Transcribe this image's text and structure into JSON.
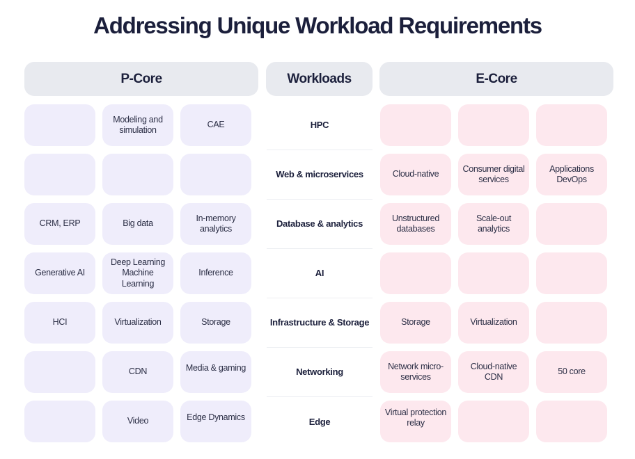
{
  "title": "Addressing Unique Workload Requirements",
  "headers": {
    "p_core": "P-Core",
    "workloads": "Workloads",
    "e_core": "E-Core"
  },
  "colors": {
    "title_text": "#1b1f3b",
    "header_bg": "#e8eaef",
    "p_core_cell_bg": "#efedfb",
    "e_core_cell_bg": "#fde8ee",
    "divider": "#eceef2"
  },
  "rows": [
    {
      "workload": "HPC",
      "p_core": [
        "",
        "Modeling and simulation",
        "CAE"
      ],
      "e_core": [
        "",
        "",
        ""
      ]
    },
    {
      "workload": "Web & microservices",
      "p_core": [
        "",
        "",
        ""
      ],
      "e_core": [
        "Cloud-native",
        "Consumer digital services",
        "Applications DevOps"
      ]
    },
    {
      "workload": "Database & analytics",
      "p_core": [
        "CRM, ERP",
        "Big data",
        "In-memory analytics"
      ],
      "e_core": [
        "Unstructured databases",
        "Scale-out analytics",
        ""
      ]
    },
    {
      "workload": "AI",
      "p_core": [
        "Generative AI",
        "Deep Learning Machine Learning",
        "Inference"
      ],
      "e_core": [
        "",
        "",
        ""
      ]
    },
    {
      "workload": "Infrastructure & Storage",
      "p_core": [
        "HCI",
        "Virtualization",
        "Storage"
      ],
      "e_core": [
        "Storage",
        "Virtualization",
        ""
      ]
    },
    {
      "workload": "Networking",
      "p_core": [
        "",
        "CDN",
        "Media & gaming"
      ],
      "e_core": [
        "Network micro-services",
        "Cloud-native CDN",
        "50 core"
      ]
    },
    {
      "workload": "Edge",
      "p_core": [
        "",
        "Video",
        "Edge Dynamics"
      ],
      "e_core": [
        "Virtual protection relay",
        "",
        ""
      ]
    }
  ]
}
